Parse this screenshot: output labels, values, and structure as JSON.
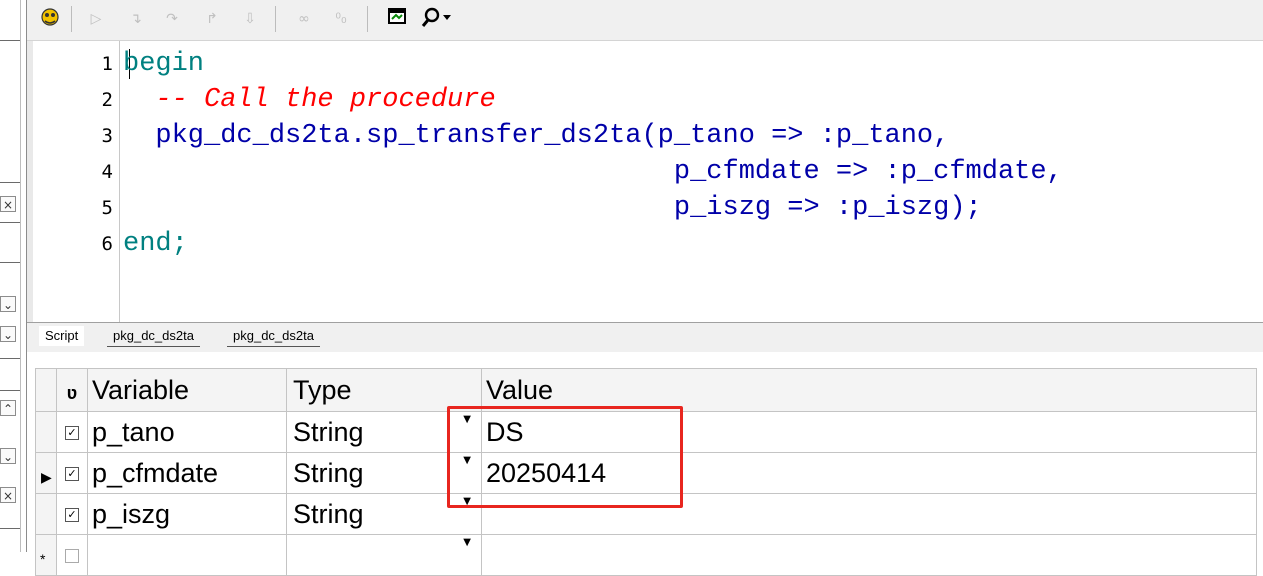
{
  "toolbar": {
    "icons": [
      "wizard-icon",
      "run-icon",
      "step-into-icon",
      "step-over-icon",
      "step-out-icon",
      "run-to-exception-icon",
      "watch-icon",
      "breakpoint-icon",
      "window-icon",
      "find-icon"
    ]
  },
  "editor": {
    "line_numbers": [
      "1",
      "2",
      "3",
      "4",
      "5",
      "6"
    ],
    "lines": [
      "begin",
      "  -- Call the procedure",
      "  pkg_dc_ds2ta.sp_transfer_ds2ta(p_tano => :p_tano,",
      "                                  p_cfmdate => :p_cfmdate,",
      "                                  p_iszg => :p_iszg);",
      "end;"
    ]
  },
  "tabs": [
    {
      "label": "Script",
      "active": true
    },
    {
      "label": "pkg_dc_ds2ta",
      "active": false
    },
    {
      "label": "pkg_dc_ds2ta",
      "active": false
    }
  ],
  "grid": {
    "headers": {
      "indicator": "ʋ",
      "variable": "Variable",
      "type": "Type",
      "value": "Value"
    },
    "rows": [
      {
        "checked": true,
        "variable": "p_tano",
        "type": "String",
        "value": "DS",
        "current": false
      },
      {
        "checked": true,
        "variable": "p_cfmdate",
        "type": "String",
        "value": "20250414",
        "current": true
      },
      {
        "checked": true,
        "variable": "p_iszg",
        "type": "String",
        "value": "",
        "current": false
      }
    ],
    "new_row_marker": "*"
  },
  "colors": {
    "keyword": "#008080",
    "comment": "#ff0000",
    "code": "#0000a8",
    "highlight": "#e8261f"
  }
}
